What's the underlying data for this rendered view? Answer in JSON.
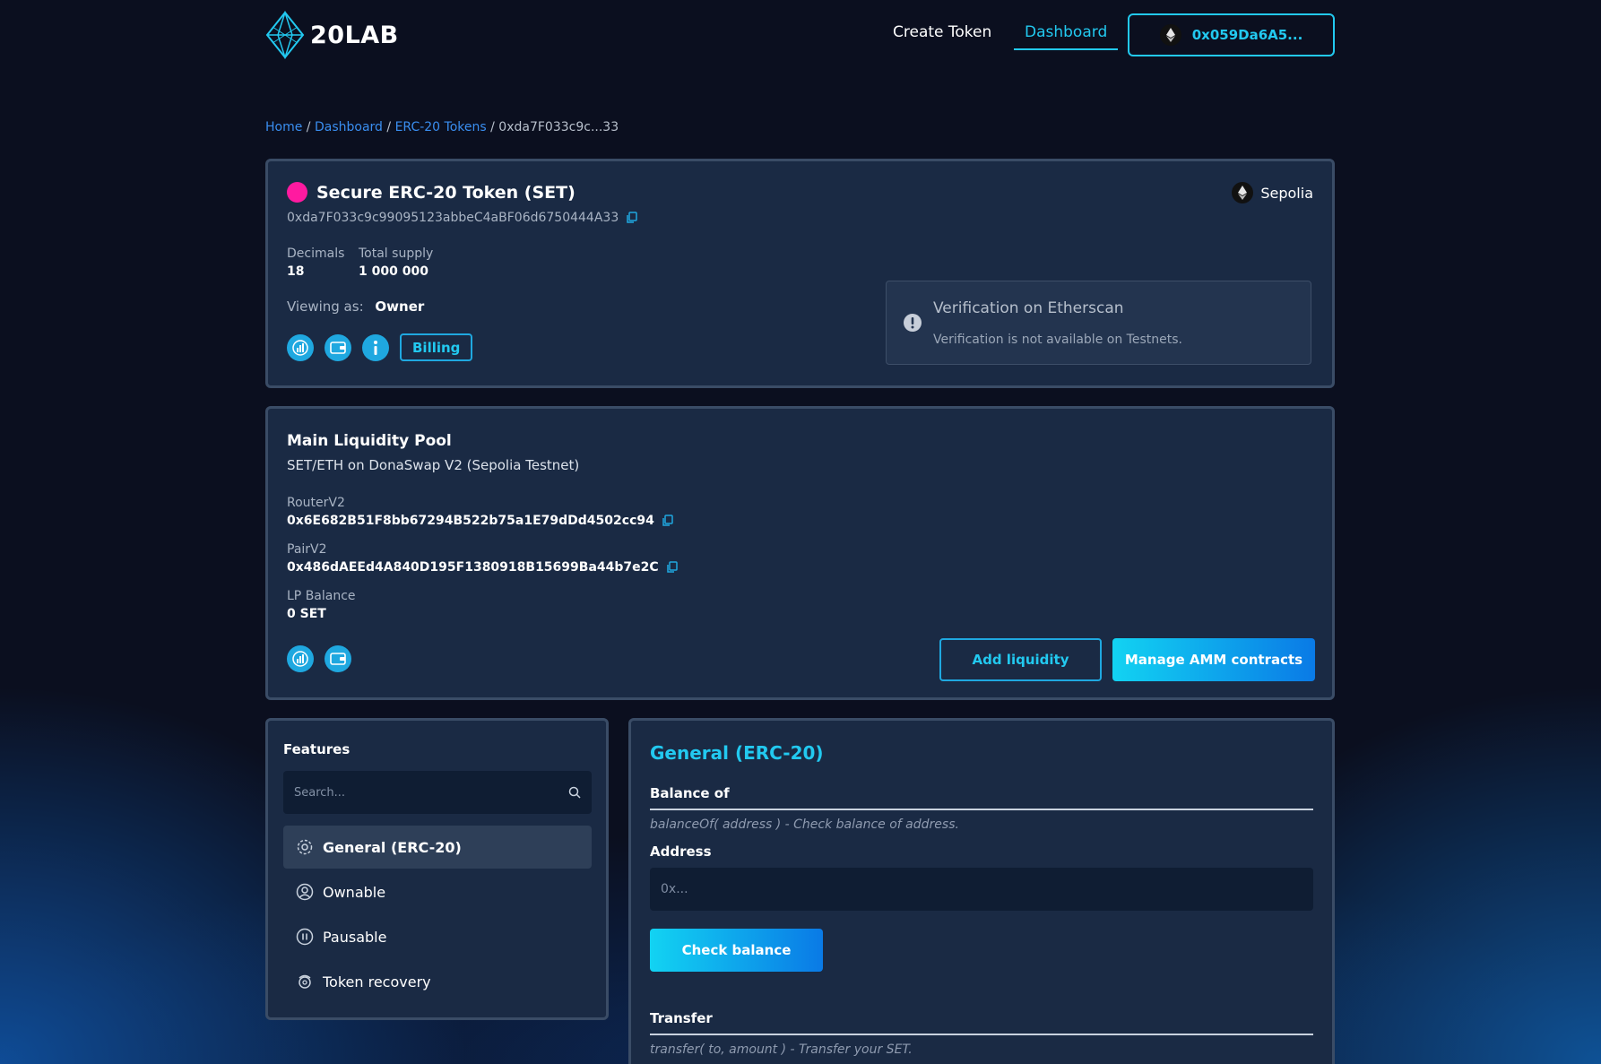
{
  "header": {
    "logo_text": "20LAB",
    "nav_create": "Create Token",
    "nav_dashboard": "Dashboard",
    "wallet_address": "0x059Da6A5..."
  },
  "breadcrumb": {
    "home": "Home",
    "dashboard": "Dashboard",
    "tokens": "ERC-20 Tokens",
    "current": "0xda7F033c9c...33",
    "separator": "/"
  },
  "token": {
    "title": "Secure ERC-20 Token (SET)",
    "address": "0xda7F033c9c99095123abbeC4aBF06d6750444A33",
    "network": "Sepolia",
    "decimals_label": "Decimals",
    "decimals_value": "18",
    "supply_label": "Total supply",
    "supply_value": "1 000 000",
    "viewing_label": "Viewing as:",
    "viewing_value": "Owner",
    "billing_label": "Billing",
    "accent_color": "#ff1aa0"
  },
  "verification": {
    "title": "Verification on Etherscan",
    "message": "Verification is not available on Testnets."
  },
  "pool": {
    "title": "Main Liquidity Pool",
    "subtitle": "SET/ETH on DonaSwap V2 (Sepolia Testnet)",
    "router_label": "RouterV2",
    "router_value": "0x6E682B51F8bb67294B522b75a1E79dDd4502cc94",
    "pair_label": "PairV2",
    "pair_value": "0x486dAEEd4A840D195F1380918B15699Ba44b7e2C",
    "lp_label": "LP Balance",
    "lp_value": "0 SET",
    "add_liquidity": "Add liquidity",
    "manage_amm": "Manage AMM contracts"
  },
  "features": {
    "title": "Features",
    "search_placeholder": "Search...",
    "items": [
      {
        "label": "General (ERC-20)",
        "icon": "gear-icon",
        "active": true
      },
      {
        "label": "Ownable",
        "icon": "user-circle-icon",
        "active": false
      },
      {
        "label": "Pausable",
        "icon": "pause-icon",
        "active": false
      },
      {
        "label": "Token recovery",
        "icon": "recovery-icon",
        "active": false
      }
    ]
  },
  "general": {
    "title": "General (ERC-20)",
    "balance_heading": "Balance of",
    "balance_desc": "balanceOf( address ) - Check balance of address.",
    "address_label": "Address",
    "address_placeholder": "0x...",
    "check_button": "Check balance",
    "transfer_heading": "Transfer",
    "transfer_desc": "transfer( to, amount ) - Transfer your SET."
  },
  "colors": {
    "accent": "#22c9f0",
    "link": "#3a8ef0",
    "card": "#1a2a44",
    "background": "#0b0f1f"
  }
}
